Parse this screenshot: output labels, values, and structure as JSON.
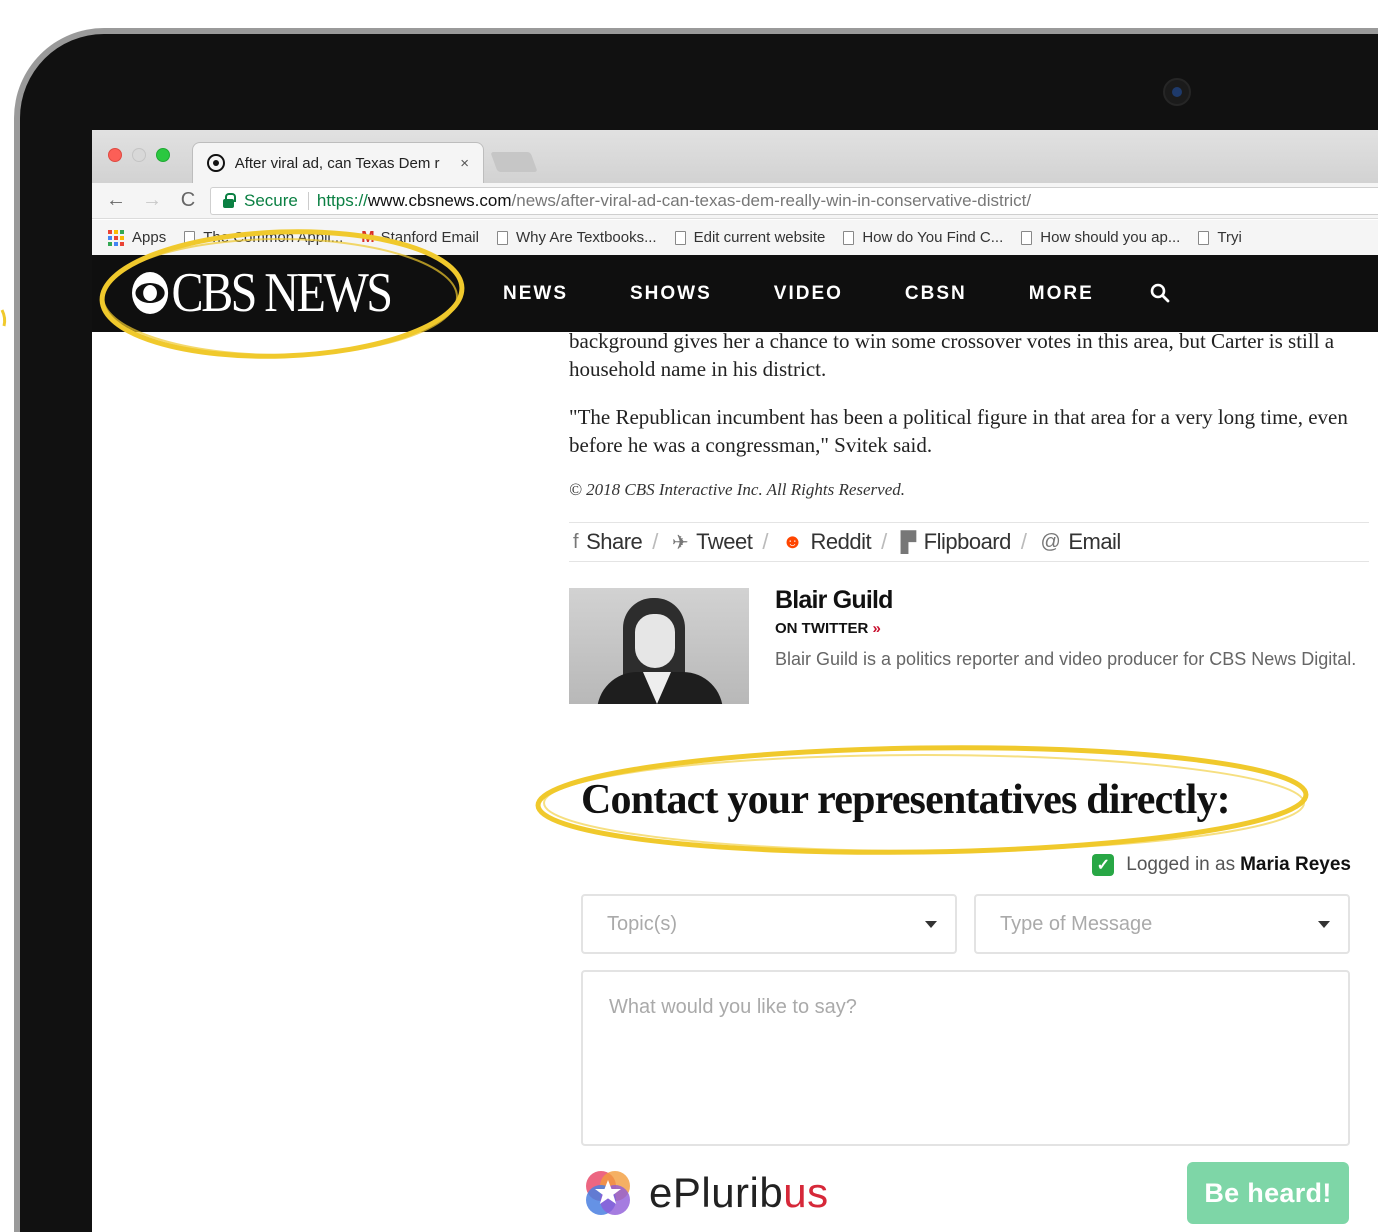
{
  "browser": {
    "tab_title": "After viral ad, can Texas Dem r",
    "tab_close": "×",
    "secure_label": "Secure",
    "url_scheme": "https://",
    "url_host": "www.cbsnews.com",
    "url_path": "/news/after-viral-ad-can-texas-dem-really-win-in-conservative-district/",
    "bookmarks": [
      "Apps",
      "The Common Appli...",
      "Stanford Email",
      "Why Are Textbooks...",
      "Edit current website",
      "How do You Find C...",
      "How should you ap...",
      "Tryi"
    ]
  },
  "cbs": {
    "logo_text": "CBS NEWS",
    "menu": [
      "NEWS",
      "SHOWS",
      "VIDEO",
      "CBSN",
      "MORE"
    ]
  },
  "article": {
    "para1": "background gives her a chance to win some crossover votes in this area, but Carter is still a household name in his district.",
    "para2": "\"The Republican incumbent has been a political figure in that area for a very long time, even before he was a congressman,\" Svitek said.",
    "copyright": "© 2018 CBS Interactive Inc. All Rights Reserved."
  },
  "share": {
    "share": "Share",
    "tweet": "Tweet",
    "reddit": "Reddit",
    "flipboard": "Flipboard",
    "email": "Email"
  },
  "author": {
    "name": "Blair Guild",
    "twitter": "ON TWITTER",
    "twitter_arrow": "»",
    "bio": "Blair Guild is a politics reporter and video producer for CBS News Digital."
  },
  "contact": {
    "heading": "Contact your representatives directly:",
    "logged_in_prefix": "Logged in as",
    "logged_in_user": "Maria Reyes",
    "topic_placeholder": "Topic(s)",
    "type_placeholder": "Type of Message",
    "message_placeholder": "What would you like to say?",
    "brand_main": "ePlurib",
    "brand_accent": "us",
    "submit": "Be heard!"
  },
  "colors": {
    "annotation": "#f0c92c",
    "secure_green": "#0b8043",
    "submit_green": "#7ed6a7",
    "check_green": "#28a745",
    "brand_red": "#d62839"
  }
}
